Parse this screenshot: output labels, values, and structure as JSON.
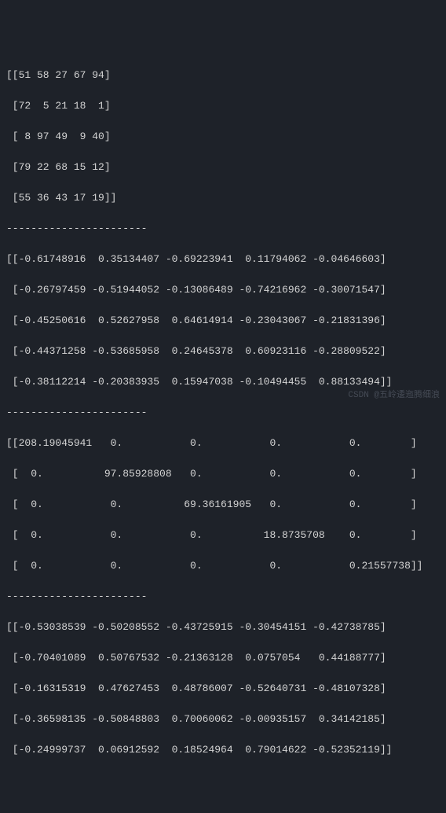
{
  "matrix1": {
    "rows": [
      "[[51 58 27 67 94]",
      " [72  5 21 18  1]",
      " [ 8 97 49  9 40]",
      " [79 22 68 15 12]",
      " [55 36 43 17 19]]"
    ]
  },
  "separator": "-----------------------",
  "matrix2": {
    "rows": [
      "[[-0.61748916  0.35134407 -0.69223941  0.11794062 -0.04646603]",
      " [-0.26797459 -0.51944052 -0.13086489 -0.74216962 -0.30071547]",
      " [-0.45250616  0.52627958  0.64614914 -0.23043067 -0.21831396]",
      " [-0.44371258 -0.53685958  0.24645378  0.60923116 -0.28809522]",
      " [-0.38112214 -0.20383935  0.15947038 -0.10494455  0.88133494]]"
    ]
  },
  "matrix3": {
    "rows": [
      "[[208.19045941   0.           0.           0.           0.        ]",
      " [  0.          97.85928808   0.           0.           0.        ]",
      " [  0.           0.          69.36161905   0.           0.        ]",
      " [  0.           0.           0.          18.8735708    0.        ]",
      " [  0.           0.           0.           0.           0.21557738]]"
    ]
  },
  "matrix4": {
    "rows": [
      "[[-0.53038539 -0.50208552 -0.43725915 -0.30454151 -0.42738785]",
      " [-0.70401089  0.50767532 -0.21363128  0.0757054   0.44188777]",
      " [-0.16315319  0.47627453  0.48786007 -0.52640731 -0.48107328]",
      " [-0.36598135 -0.50848803  0.70060062 -0.00935157  0.34142185]",
      " [-0.24999737  0.06912592  0.18524964  0.79014622 -0.52352119]]"
    ]
  },
  "watermark": "CSDN @五岭逶迤腾细浪"
}
